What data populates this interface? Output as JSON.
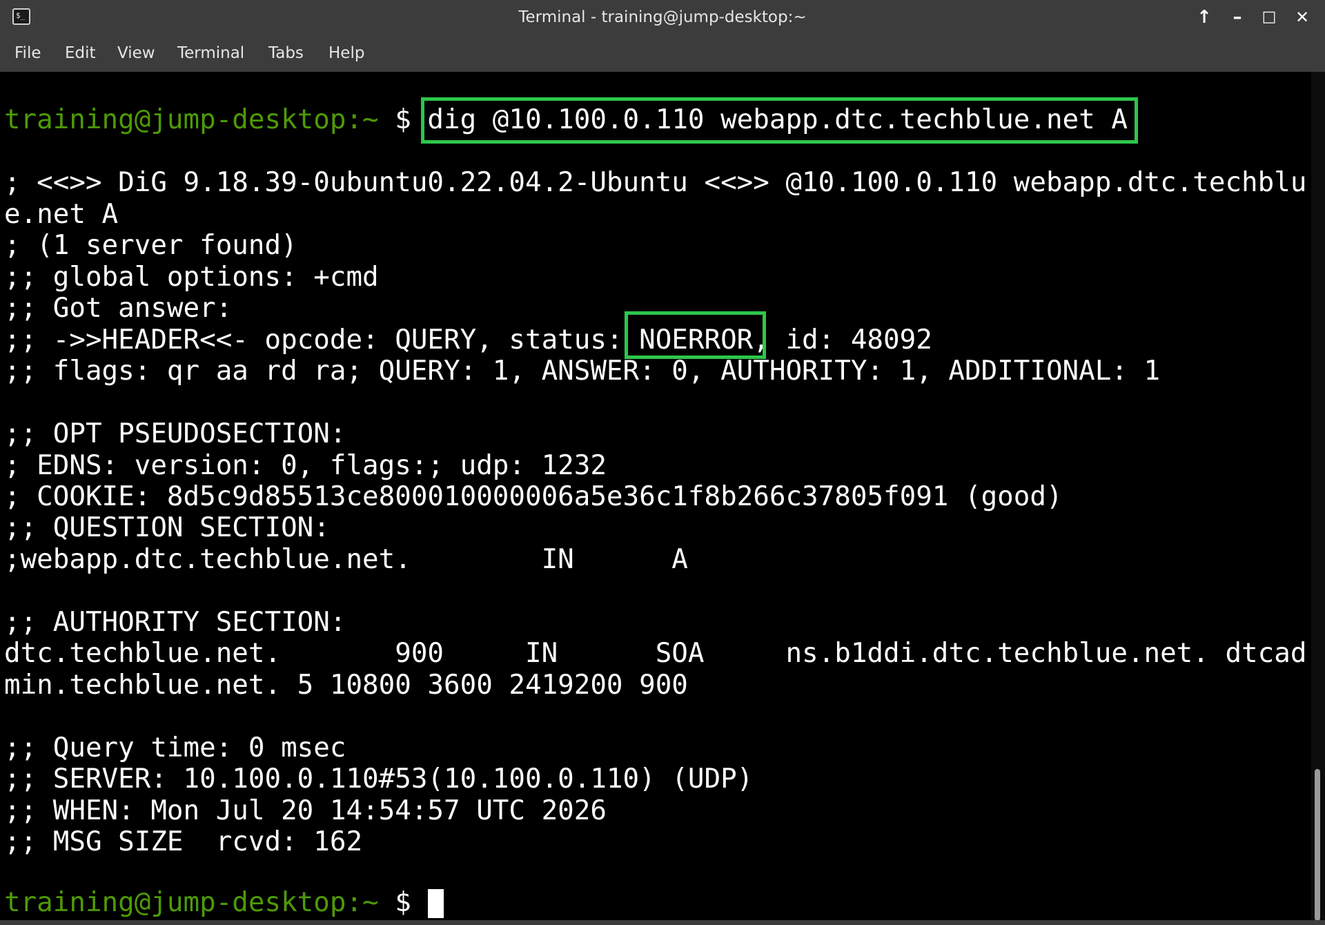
{
  "window": {
    "title": "Terminal - training@jump-desktop:~",
    "buttons": {
      "up": "↑",
      "minimize": "–",
      "maximize": "□",
      "close": "✕"
    },
    "icon": "terminal-icon",
    "icon_text": "$_"
  },
  "menu": {
    "items": [
      "File",
      "Edit",
      "View",
      "Terminal",
      "Tabs",
      "Help"
    ]
  },
  "terminal": {
    "prompt_user": "training@jump-desktop",
    "prompt_path": ":~",
    "prompt_symbol": " $ ",
    "command": "dig @10.100.0.110 webapp.dtc.techblue.net A",
    "output": [
      "; <<>> DiG 9.18.39-0ubuntu0.22.04.2-Ubuntu <<>> @10.100.0.110 webapp.dtc.techblu",
      "e.net A",
      "; (1 server found)",
      ";; global options: +cmd",
      ";; Got answer:",
      ";; ->>HEADER<<- opcode: QUERY, status: NOERROR, id: 48092",
      ";; flags: qr aa rd ra; QUERY: 1, ANSWER: 0, AUTHORITY: 1, ADDITIONAL: 1",
      "",
      ";; OPT PSEUDOSECTION:",
      "; EDNS: version: 0, flags:; udp: 1232",
      "; COOKIE: 8d5c9d85513ce800010000006a5e36c1f8b266c37805f091 (good)",
      ";; QUESTION SECTION:",
      ";webapp.dtc.techblue.net.        IN      A",
      "",
      ";; AUTHORITY SECTION:",
      "dtc.techblue.net.       900     IN      SOA     ns.b1ddi.dtc.techblue.net. dtcad",
      "min.techblue.net. 5 10800 3600 2419200 900",
      "",
      ";; Query time: 0 msec",
      ";; SERVER: 10.100.0.110#53(10.100.0.110) (UDP)",
      ";; WHEN: Mon Jul 20 14:54:57 UTC 2026",
      ";; MSG SIZE  rcvd: 162"
    ]
  },
  "highlight_color": "#2ec64b",
  "prompt_color": "#4e9a06"
}
